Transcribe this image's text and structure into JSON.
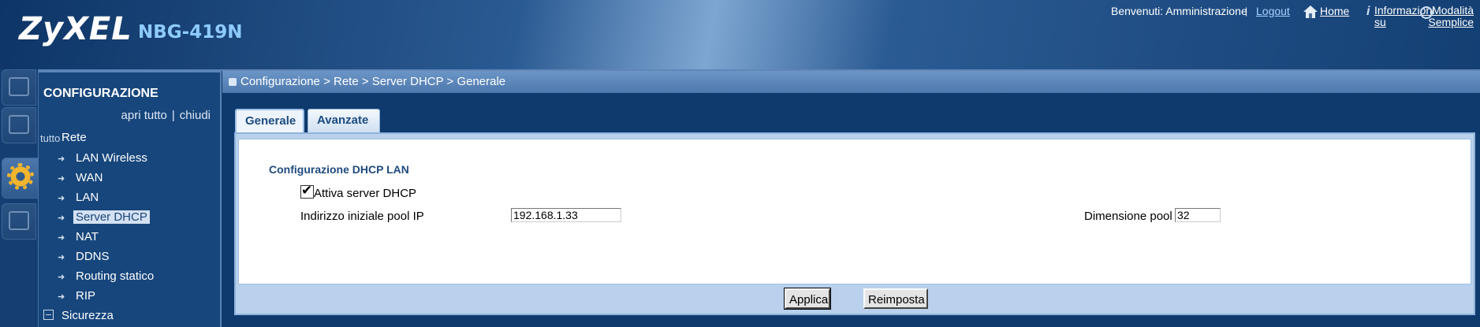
{
  "header": {
    "brand": "ZyXEL",
    "model": "NBG-419N",
    "welcome": "Benvenuti: Amministrazione",
    "separator": "|",
    "logout": "Logout",
    "home": "Home",
    "info": "Informazioni su",
    "simple_mode": "Modalità Semplice",
    "icons": [
      "home-icon",
      "info-icon",
      "simple-mode-icon"
    ]
  },
  "side_tabs": [
    "status-icon",
    "monitor-icon",
    "config-gear-icon",
    "maintenance-icon"
  ],
  "nav": {
    "title": "CONFIGURAZIONE",
    "expand_all": "apri tutto",
    "separator": "|",
    "collapse_all": "chiudi",
    "root_icon_text": "tutto",
    "root": "Rete",
    "items": [
      {
        "label": "LAN Wireless"
      },
      {
        "label": "WAN"
      },
      {
        "label": "LAN"
      },
      {
        "label": "Server DHCP",
        "selected": true
      },
      {
        "label": "NAT"
      },
      {
        "label": "DDNS"
      },
      {
        "label": "Routing statico"
      },
      {
        "label": "RIP"
      }
    ],
    "section2": "Sicurezza"
  },
  "breadcrumb": "Configurazione > Rete > Server DHCP > Generale",
  "tabs": [
    "Generale",
    "Avanzate"
  ],
  "form": {
    "section_title": "Configurazione DHCP LAN",
    "enable_label": "Attiva server DHCP",
    "enable_checked": true,
    "ip_label": "Indirizzo iniziale pool IP",
    "ip_value": "192.168.1.33",
    "pool_label": "Dimensione pool",
    "pool_value": "32"
  },
  "buttons": {
    "apply": "Applica",
    "reset": "Reimposta"
  },
  "colors": {
    "header_dark": "#0e3566",
    "nav_bg": "#17467c",
    "accent_text": "#1f4b7e",
    "model_text": "#8ecbff",
    "button_bar": "#b9d1ec"
  }
}
